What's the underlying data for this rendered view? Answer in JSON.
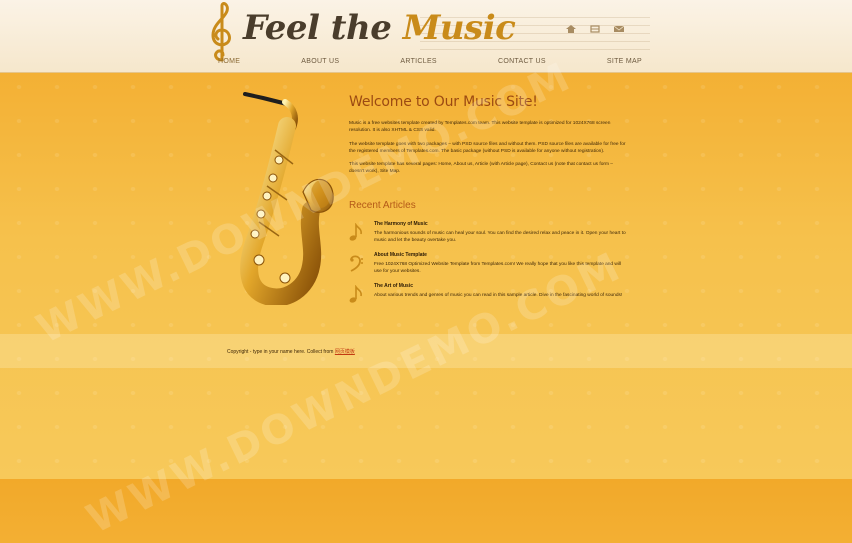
{
  "header": {
    "logo_word1": "Feel the ",
    "logo_word2": "Music",
    "icons": [
      "home-icon",
      "sitemap-icon",
      "mail-icon"
    ]
  },
  "nav": {
    "items": [
      {
        "label": "HOME"
      },
      {
        "label": "ABOUT US"
      },
      {
        "label": "ARTICLES"
      },
      {
        "label": "CONTACT US"
      },
      {
        "label": "SITE MAP"
      }
    ]
  },
  "main": {
    "welcome": "Welcome to Our Music Site!",
    "paragraphs": [
      "Music is a free websites template created by Templates.com team. This website template is optimized for 1024X768 screen resolution. It is also XHTML & CSS valid.",
      "The website template goes with two packages – with PSD source files and without them. PSD source files are available for free for the registered members of Templates.com. The basic package (without PSD is available for anyone without registration).",
      "This website template has several pages: Home, About us, Article (with Article page), Contact us (note that contact us form – doesn't work), Site Map."
    ],
    "recent_title": "Recent Articles",
    "articles": [
      {
        "title": "The Harmony of Music",
        "text": "The harmonious sounds of music can heal your soul. You can find the desired relax and peace in it. Open your heart to music and let the beauty overtake you.",
        "icon": "eighth-note-icon"
      },
      {
        "title": "About Music Template",
        "text": "Free 1024X768 Optimized Website Template from Templates.com! We really hope that you like this template and will use for your websites.",
        "icon": "bass-clef-icon"
      },
      {
        "title": "The Art of Music",
        "text": "About various trends and genres of music you can read in this sample article. Dive in the fascinating world of sounds!",
        "icon": "eighth-note-icon"
      }
    ]
  },
  "footer": {
    "text": "Copyright - type in your name here. Collect from ",
    "link": "网页模板"
  },
  "watermark": "WWW.DOWNDEMO.COM",
  "colors": {
    "background": "#f2a92a",
    "heading": "#9c4a12",
    "accent": "#c98b1a",
    "link": "#c23a12"
  }
}
